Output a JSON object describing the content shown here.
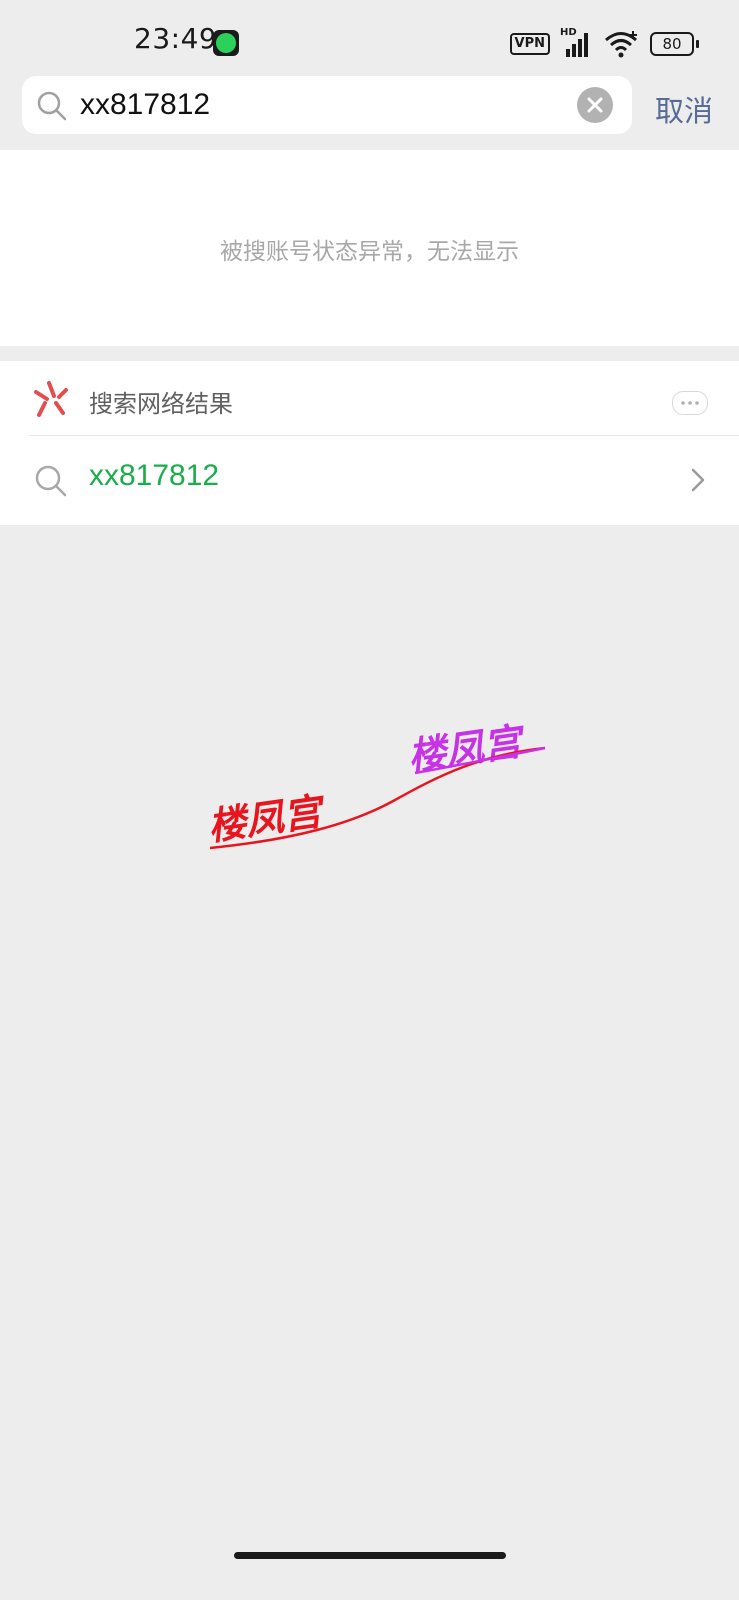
{
  "status_bar": {
    "time": "23:49",
    "vpn_label": "VPN",
    "network_label": "HD",
    "battery_level": "80",
    "icons": [
      "app-notification-icon",
      "signal-icon",
      "wifi-icon",
      "battery-icon"
    ]
  },
  "search": {
    "query": "xx817812",
    "cancel_label": "取消"
  },
  "notice": {
    "message": "被搜账号状态异常，无法显示"
  },
  "web_results": {
    "title": "搜索网络结果",
    "items": [
      {
        "label": "xx817812"
      }
    ]
  },
  "watermark": {
    "text_left": "楼凤宫",
    "text_right": "楼凤宫",
    "colors": {
      "left": "#e8141e",
      "right": "#c832e6"
    }
  },
  "colors": {
    "background": "#ededed",
    "accent_green": "#1aad4b",
    "link_blue": "#576b95"
  }
}
